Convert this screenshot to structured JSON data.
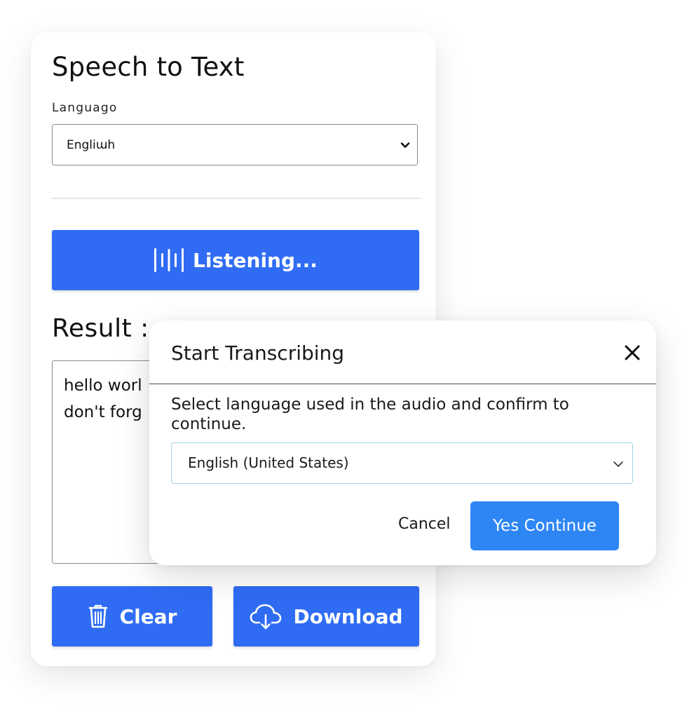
{
  "app": {
    "title": "Speech to Text",
    "language_label": "Languago",
    "language_value": "Engliɯh",
    "listen_button_label": "Listening...",
    "result_label": "Result :",
    "result_lines": [
      "hello worl",
      "don't forg"
    ],
    "clear_button_label": "Clear",
    "download_button_label": "Download"
  },
  "dialog": {
    "title": "Start Transcribing",
    "message": "Select language used in the audio and confirm to continue.",
    "language_value": "English (United States)",
    "cancel_label": "Cancel",
    "confirm_label": "Yes Continue"
  },
  "colors": {
    "primary_button": "#2f6cf3",
    "confirm_button": "#2e86f5",
    "select_focus_border": "#9fd3e6"
  },
  "icons": {
    "listen": "sound-wave-icon",
    "clear": "trash-icon",
    "download": "cloud-download-icon",
    "close": "close-icon",
    "dropdown": "chevron-down-icon"
  }
}
